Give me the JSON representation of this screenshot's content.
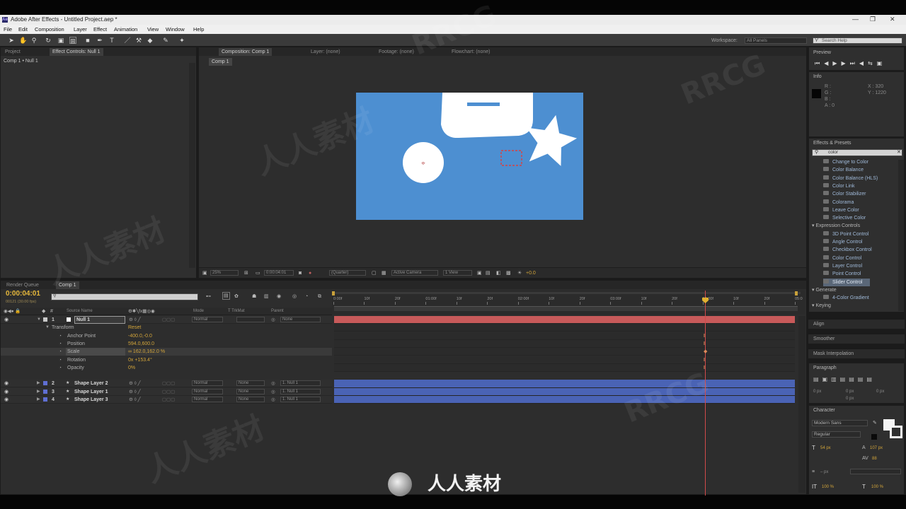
{
  "window": {
    "title": "Adobe After Effects - Untitled Project.aep *",
    "app_icon": "Ae"
  },
  "menu": [
    "File",
    "Edit",
    "Composition",
    "Layer",
    "Effect",
    "Animation",
    "View",
    "Window",
    "Help"
  ],
  "toolbar": {
    "workspace_label": "Workspace:",
    "workspace_value": "All Panels",
    "search_placeholder": "Search Help"
  },
  "project_panel": {
    "tab_project": "Project",
    "tab_effect_controls": "Effect Controls: Null 1",
    "breadcrumb": "Comp 1 • Null 1"
  },
  "comp_panel": {
    "tab_composition": "Composition: Comp 1",
    "tab_layer": "Layer: (none)",
    "tab_footage": "Footage: (none)",
    "tab_flowchart": "Flowchart: (none)",
    "comp_tab": "Comp 1",
    "zoom": "25%",
    "timecode": "0:00:04:01",
    "resolution": "(Quarter)",
    "camera": "Active Camera",
    "view": "1 View",
    "exposure": "+0.0",
    "canvas_bg": "#4d8fd1"
  },
  "timeline": {
    "tab_render_queue": "Render Queue",
    "tab_comp": "Comp 1",
    "timecode": "0:00:04:01",
    "frames": "00121 (30.00 fps)",
    "search_placeholder": "",
    "col_source": "Source Name",
    "col_mode": "Mode",
    "col_trkmat": "T TrkMat",
    "col_parent": "Parent",
    "ruler_labels": [
      "0:00f",
      "10f",
      "20f",
      "01:00f",
      "10f",
      "20f",
      "02:00f",
      "10f",
      "20f",
      "03:00f",
      "10f",
      "20f",
      "04:00f",
      "10f",
      "20f",
      "05:0"
    ],
    "current_time_fraction": 0.8,
    "layers": [
      {
        "num": "1",
        "name": "Null 1",
        "mode": "Normal",
        "trkmat": "",
        "parent": "None",
        "color": "#c9c9c9",
        "bar": "#c85a5a"
      },
      {
        "num": "2",
        "name": "Shape Layer 2",
        "mode": "Normal",
        "trkmat": "None",
        "parent": "1. Null 1",
        "color": "#5f6fd3",
        "bar": "#4a63b5"
      },
      {
        "num": "3",
        "name": "Shape Layer 1",
        "mode": "Normal",
        "trkmat": "None",
        "parent": "1. Null 1",
        "color": "#5f6fd3",
        "bar": "#4a63b5"
      },
      {
        "num": "4",
        "name": "Shape Layer 3",
        "mode": "Normal",
        "trkmat": "None",
        "parent": "1. Null 1",
        "color": "#5f6fd3",
        "bar": "#4a63b5"
      }
    ],
    "transform": {
      "label": "Transform",
      "reset": "Reset",
      "props": [
        {
          "name": "Anchor Point",
          "value": "-400.0,-0.0"
        },
        {
          "name": "Position",
          "value": "594.0,600.0"
        },
        {
          "name": "Scale",
          "value": "∞ 162.0,162.0 %"
        },
        {
          "name": "Rotation",
          "value": "0x +153.4°"
        },
        {
          "name": "Opacity",
          "value": "0%"
        }
      ]
    }
  },
  "preview": {
    "title": "Preview"
  },
  "info": {
    "title": "Info",
    "r": "R :",
    "g": "G :",
    "b": "B :",
    "a": "A : 0",
    "x": "X : 320",
    "y": "Y : 1220"
  },
  "effects": {
    "title": "Effects & Presets",
    "search_value": "color",
    "items": [
      {
        "label": "Change to Color",
        "type": "item"
      },
      {
        "label": "Color Balance",
        "type": "item"
      },
      {
        "label": "Color Balance (HLS)",
        "type": "item"
      },
      {
        "label": "Color Link",
        "type": "item"
      },
      {
        "label": "Color Stabilizer",
        "type": "item"
      },
      {
        "label": "Colorama",
        "type": "item"
      },
      {
        "label": "Leave Color",
        "type": "item"
      },
      {
        "label": "Selective Color",
        "type": "item"
      },
      {
        "label": "Expression Controls",
        "type": "group"
      },
      {
        "label": "3D Point Control",
        "type": "item"
      },
      {
        "label": "Angle Control",
        "type": "item"
      },
      {
        "label": "Checkbox Control",
        "type": "item"
      },
      {
        "label": "Color Control",
        "type": "item"
      },
      {
        "label": "Layer Control",
        "type": "item"
      },
      {
        "label": "Point Control",
        "type": "item"
      },
      {
        "label": "Slider Control",
        "type": "selected"
      },
      {
        "label": "Generate",
        "type": "group"
      },
      {
        "label": "4-Color Gradient",
        "type": "item"
      },
      {
        "label": "Keying",
        "type": "group"
      }
    ]
  },
  "right_panels": {
    "align": "Align",
    "smoother": "Smoother",
    "mask_interpolation": "Mask Interpolation",
    "paragraph": "Paragraph",
    "character": "Character"
  },
  "character": {
    "font": "Modern Sans",
    "style": "Regular",
    "size": "54 px",
    "leading": "107 px",
    "kerning": "88",
    "stroke": "– px",
    "scale_v": "100 %",
    "scale_h": "100 %",
    "para_px": "0 px"
  },
  "watermark": {
    "texts": [
      "RRCG",
      "人人素材",
      "RRCG",
      "人人素材",
      "RRCG",
      "人人素材"
    ],
    "footer": "人人素材"
  }
}
